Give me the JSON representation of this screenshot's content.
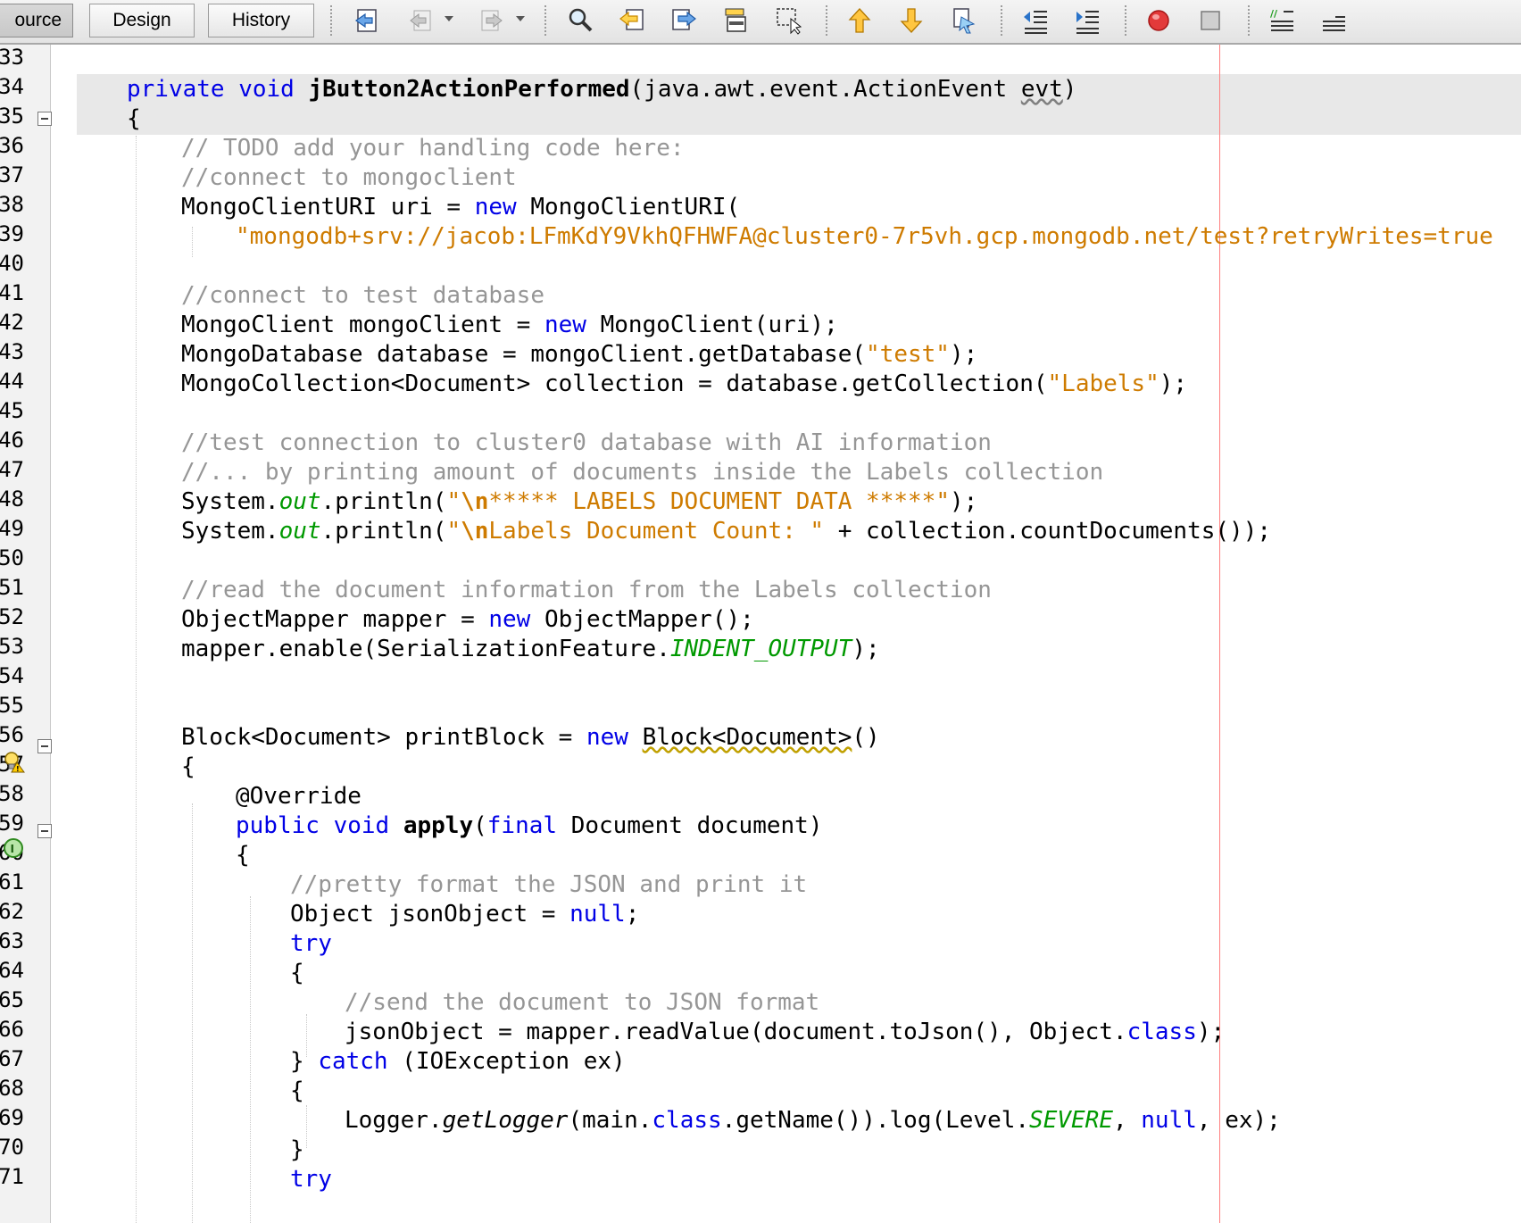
{
  "toolbar": {
    "tabs": [
      {
        "label": "ource",
        "active": true
      },
      {
        "label": "Design",
        "active": false
      },
      {
        "label": "History",
        "active": false
      }
    ],
    "buttons": [
      "last-edit-icon",
      "back-icon",
      "forward-icon",
      "find-icon",
      "find-previous-icon",
      "find-next-icon",
      "toggle-highlight-icon",
      "toggle-rect-selection-icon",
      "previous-bookmark-icon",
      "next-bookmark-icon",
      "toggle-bookmark-icon",
      "shift-left-icon",
      "shift-right-icon",
      "start-macro-icon",
      "stop-macro-icon",
      "comment-icon",
      "uncomment-icon"
    ]
  },
  "gutter": {
    "line_numbers": [
      "33",
      "34",
      "35",
      "36",
      "37",
      "38",
      "39",
      "40",
      "41",
      "42",
      "43",
      "44",
      "45",
      "46",
      "47",
      "48",
      "49",
      "50",
      "51",
      "52",
      "53",
      "54",
      "55",
      "56",
      "57",
      "58",
      "59",
      "60",
      "61",
      "62",
      "63",
      "64",
      "65",
      "66",
      "67",
      "68",
      "69",
      "70",
      "71"
    ]
  },
  "code": {
    "l34": {
      "kw1": "private void ",
      "name": "jButton2ActionPerformed",
      "params": "(java.awt.event.ActionEvent ",
      "evt": "evt",
      "close": ")"
    },
    "l35": "{",
    "l36": "// TODO add your handling code here:",
    "l37": "//connect to mongoclient",
    "l38": {
      "a": "MongoClientURI uri = ",
      "kw": "new",
      "b": " MongoClientURI("
    },
    "l39": "\"mongodb+srv://jacob:LFmKdY9VkhQFHWFA@cluster0-7r5vh.gcp.mongodb.net/test?retryWrites=true",
    "l41": "//connect to test database",
    "l42": {
      "a": "MongoClient mongoClient = ",
      "kw": "new",
      "b": " MongoClient(uri);"
    },
    "l43": {
      "a": "MongoDatabase database = mongoClient.getDatabase(",
      "s": "\"test\"",
      "b": ");"
    },
    "l44": {
      "a": "MongoCollection<Document> collection = database.getCollection(",
      "s": "\"Labels\"",
      "b": ");"
    },
    "l46": "//test connection to cluster0 database with AI information",
    "l47": "//... by printing amount of documents inside the Labels collection",
    "l48": {
      "a": "System.",
      "f": "out",
      "b": ".println(",
      "q": "\"",
      "e": "\\n",
      "s": "***** LABELS DOCUMENT DATA *****\"",
      "c": ");"
    },
    "l49": {
      "a": "System.",
      "f": "out",
      "b": ".println(",
      "q": "\"",
      "e": "\\n",
      "s": "Labels Document Count: \"",
      "c": " + collection.countDocuments());"
    },
    "l51": "//read the document information from the Labels collection",
    "l52": {
      "a": "ObjectMapper mapper = ",
      "kw": "new",
      "b": " ObjectMapper();"
    },
    "l53": {
      "a": "mapper.enable(SerializationFeature.",
      "f": "INDENT_OUTPUT",
      "b": ");"
    },
    "l56": {
      "a": "Block<Document> printBlock = ",
      "kw": "new",
      "sp": " ",
      "w": "Block<Document>",
      "b": "()"
    },
    "l57": "{",
    "l58": "@Override",
    "l59": {
      "kw1": "public void ",
      "name": "apply",
      "p": "(",
      "kw2": "final",
      "b": " Document document)"
    },
    "l60": "{",
    "l61": "//pretty format the JSON and print it",
    "l62": {
      "a": "Object jsonObject = ",
      "kw": "null",
      "b": ";"
    },
    "l63": "try",
    "l64": "{",
    "l65": "//send the document to JSON format",
    "l66": {
      "a": "jsonObject = mapper.readValue(document.toJson(), Object.",
      "kw": "class",
      "b": ");"
    },
    "l67": {
      "a": "} ",
      "kw": "catch",
      "b": " (IOException ex)"
    },
    "l68": "{",
    "l69": {
      "a": "Logger.",
      "i": "getLogger",
      "b": "(main.",
      "kw": "class",
      "c": ".getName()).log(Level.",
      "f": "SEVERE",
      "d": ", ",
      "kw2": "null",
      "e": ", ex);"
    },
    "l70": "}",
    "l71": "try"
  },
  "colors": {
    "keyword": "#0000e6",
    "comment": "#969696",
    "string": "#ce7b00",
    "field": "#009900",
    "margin_line": "#ff7f7f",
    "current_line": "#e8e8e8"
  }
}
